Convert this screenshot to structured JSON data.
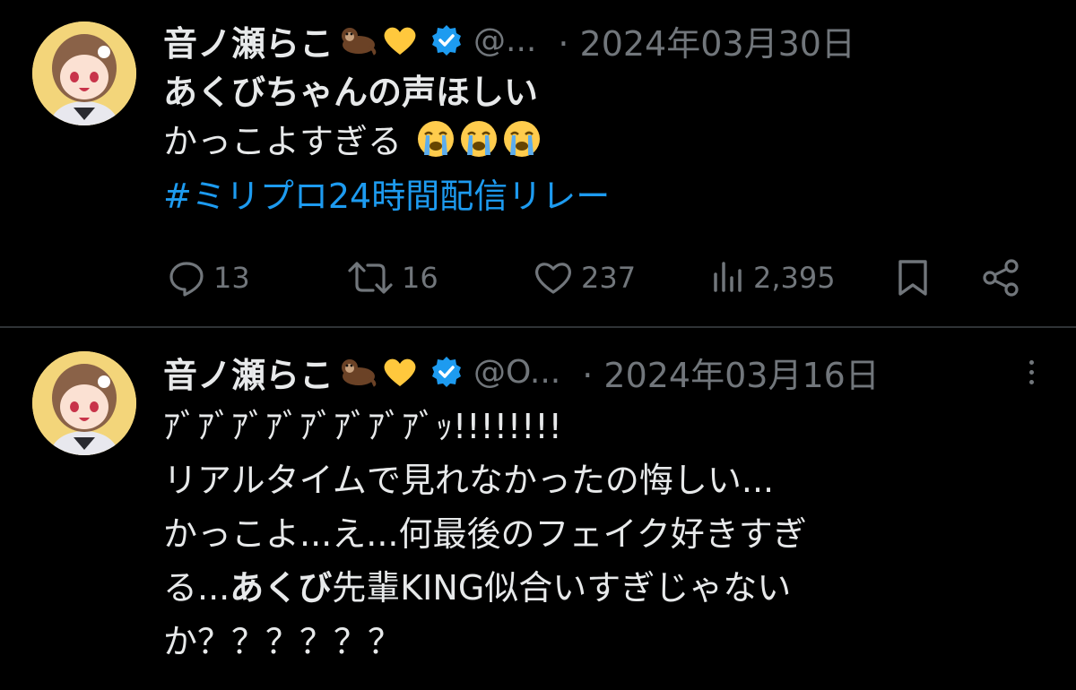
{
  "tweets": [
    {
      "display_name": "音ノ瀬らこ",
      "handle": "@...",
      "date": "· 2024年03月30日",
      "lines": {
        "l1": "あくびちゃんの声ほしい",
        "l2": "かっこよすぎる",
        "hashtag": "#ミリプロ24時間配信リレー"
      },
      "actions": {
        "reply": "13",
        "retweet": "16",
        "like": "237",
        "views": "2,395"
      }
    },
    {
      "display_name": "音ノ瀬らこ",
      "handle": "@O...",
      "date": "· 2024年03月16日",
      "lines": {
        "l1": "ｱﾞｱﾞｱﾞｱﾞｱﾞｱﾞｱﾞｱﾞｯ!!!!!!!!",
        "l2": "リアルタイムで見れなかったの悔しい...",
        "l3": "かっこよ...え...何最後のフェイク好きすぎ",
        "l4a": "る...",
        "l4b": "あくび",
        "l4c": "先輩KING似合いすぎじゃない",
        "l5": "か？？？？？？"
      }
    }
  ],
  "icons": [
    "otter-emoji-icon",
    "yellow-heart-icon",
    "verified-badge-icon",
    "crying-face-icon",
    "reply-icon",
    "retweet-icon",
    "like-icon",
    "views-icon",
    "bookmark-icon",
    "share-icon",
    "more-icon"
  ],
  "colors": {
    "background": "#000000",
    "text": "#e7e9ea",
    "muted": "#71767b",
    "hashtag": "#1d9bf0",
    "verified": "#1d9bf0"
  }
}
